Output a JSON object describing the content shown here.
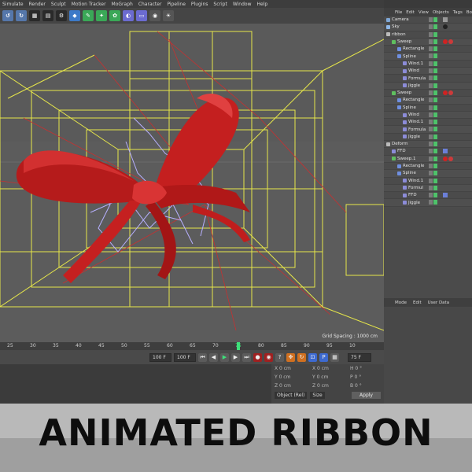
{
  "menu": [
    "Simulate",
    "Render",
    "Sculpt",
    "Motion Tracker",
    "MoGraph",
    "Character",
    "Pipeline",
    "Plugins",
    "Script",
    "Window",
    "Help"
  ],
  "viewport": {
    "grid_spacing": "Grid Spacing : 1000 cm"
  },
  "timeline": {
    "ticks": [
      "25",
      "30",
      "35",
      "40",
      "45",
      "50",
      "55",
      "60",
      "65",
      "70",
      "75",
      "80",
      "85",
      "90",
      "95",
      "10"
    ],
    "current_marker": "75",
    "current_field": "75 F"
  },
  "transport": {
    "start_field": "100 F",
    "end_field": "100 F"
  },
  "coords": {
    "rows": [
      {
        "a_label": "X",
        "a_val": "0 cm",
        "b_label": "X",
        "b_val": "0 cm",
        "c_label": "H",
        "c_val": "0 °"
      },
      {
        "a_label": "Y",
        "a_val": "0 cm",
        "b_label": "Y",
        "b_val": "0 cm",
        "c_label": "P",
        "c_val": "0 °"
      },
      {
        "a_label": "Z",
        "a_val": "0 cm",
        "b_label": "Z",
        "b_val": "0 cm",
        "c_label": "B",
        "c_val": "0 °"
      }
    ],
    "mode": "Object (Rel)",
    "size_mode": "Size",
    "apply": "Apply"
  },
  "object_manager": {
    "menu": [
      "File",
      "Edit",
      "View",
      "Objects",
      "Tags",
      "Bo"
    ],
    "objects": [
      {
        "name": "Camera",
        "indent": 0,
        "color": "#7fa7d6",
        "tag": "cam"
      },
      {
        "name": "Sky",
        "indent": 0,
        "color": "#8fb8e8",
        "tag": "sky"
      },
      {
        "name": "ribbon",
        "indent": 0,
        "color": "#bbbbbb",
        "tag": ""
      },
      {
        "name": "Sweep",
        "indent": 1,
        "color": "#5fbf5f",
        "tag": "mat"
      },
      {
        "name": "Rectangle",
        "indent": 2,
        "color": "#6f8fe0",
        "tag": ""
      },
      {
        "name": "Spline",
        "indent": 2,
        "color": "#6f8fe0",
        "tag": ""
      },
      {
        "name": "Wind.1",
        "indent": 3,
        "color": "#8c8cd8",
        "tag": ""
      },
      {
        "name": "Wind",
        "indent": 3,
        "color": "#8c8cd8",
        "tag": ""
      },
      {
        "name": "Formula",
        "indent": 3,
        "color": "#8c8cd8",
        "tag": ""
      },
      {
        "name": "Jiggle",
        "indent": 3,
        "color": "#8c8cd8",
        "tag": ""
      },
      {
        "name": "Sweep",
        "indent": 1,
        "color": "#5fbf5f",
        "tag": "mat"
      },
      {
        "name": "Rectangle",
        "indent": 2,
        "color": "#6f8fe0",
        "tag": ""
      },
      {
        "name": "Spline",
        "indent": 2,
        "color": "#6f8fe0",
        "tag": ""
      },
      {
        "name": "Wind",
        "indent": 3,
        "color": "#8c8cd8",
        "tag": ""
      },
      {
        "name": "Wind.1",
        "indent": 3,
        "color": "#8c8cd8",
        "tag": ""
      },
      {
        "name": "Formula",
        "indent": 3,
        "color": "#8c8cd8",
        "tag": ""
      },
      {
        "name": "Jiggle",
        "indent": 3,
        "color": "#8c8cd8",
        "tag": ""
      },
      {
        "name": "Deform",
        "indent": 0,
        "color": "#bbbbbb",
        "tag": ""
      },
      {
        "name": "FFD",
        "indent": 1,
        "color": "#8c8cd8",
        "tag": "ffd"
      },
      {
        "name": "Sweep.1",
        "indent": 1,
        "color": "#5fbf5f",
        "tag": "mat"
      },
      {
        "name": "Rectangle",
        "indent": 2,
        "color": "#6f8fe0",
        "tag": ""
      },
      {
        "name": "Spline",
        "indent": 2,
        "color": "#6f8fe0",
        "tag": ""
      },
      {
        "name": "Wind.1",
        "indent": 3,
        "color": "#8c8cd8",
        "tag": ""
      },
      {
        "name": "Formul",
        "indent": 3,
        "color": "#8c8cd8",
        "tag": ""
      },
      {
        "name": "FFD",
        "indent": 3,
        "color": "#8c8cd8",
        "tag": "ffd"
      },
      {
        "name": "Jiggle",
        "indent": 3,
        "color": "#8c8cd8",
        "tag": ""
      }
    ]
  },
  "attributes": {
    "menu": [
      "Mode",
      "Edit",
      "User Data"
    ]
  },
  "banner": {
    "title": "ANIMATED RIBBON"
  },
  "colors": {
    "ribbon": "#c41f1f",
    "cage": "#e6e64a",
    "spline": "#b7b0ff",
    "accent": "#3ee07a"
  },
  "icons": [
    "undo-icon",
    "redo-icon",
    "cube-icon",
    "render-icon",
    "camera-icon",
    "light-icon",
    "sky-icon"
  ]
}
